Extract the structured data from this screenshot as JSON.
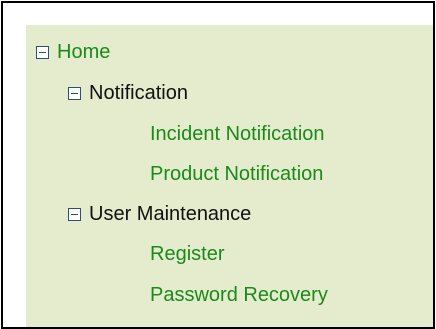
{
  "tree": {
    "root": {
      "label": "Home"
    },
    "notification": {
      "label": "Notification",
      "children": [
        "Incident Notification",
        "Product Notification"
      ]
    },
    "user_maintenance": {
      "label": "User Maintenance",
      "children": [
        "Register",
        "Password Recovery"
      ]
    }
  },
  "colors": {
    "panel_background": "#e4eccd",
    "link_green": "#1a8a1a",
    "text_black": "#111111",
    "toggle_border": "#2f4f6f"
  }
}
